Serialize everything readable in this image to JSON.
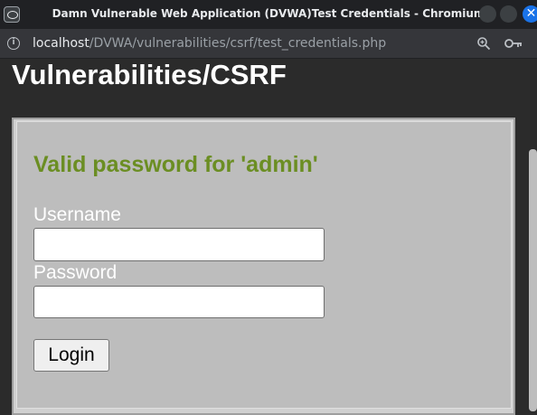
{
  "window": {
    "title": "Damn Vulnerable Web Application (DVWA)Test Credentials - Chromium",
    "close_glyph": "✕"
  },
  "address_bar": {
    "host": "localhost",
    "path": "/DVWA/vulnerabilities/csrf/test_credentials.php",
    "icons": [
      "info-icon",
      "zoom-icon",
      "key-icon"
    ]
  },
  "page": {
    "heading": "Vulnerabilities/CSRF",
    "message": "Valid password for 'admin'",
    "form": {
      "username_label": "Username",
      "username_value": "",
      "password_label": "Password",
      "password_value": "",
      "login_label": "Login"
    }
  },
  "colors": {
    "message": "#6b8e23",
    "panel": "#bdbdbd",
    "page_background": "#2b2b2b"
  }
}
